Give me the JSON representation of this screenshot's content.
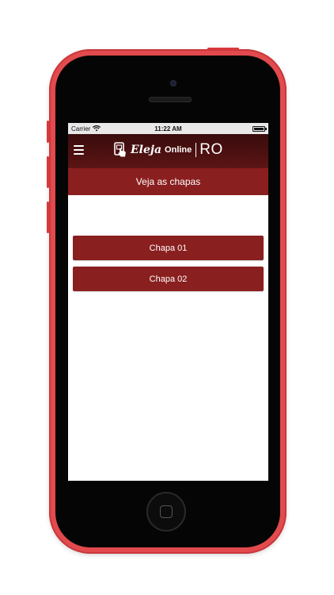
{
  "status_bar": {
    "carrier": "Carrier",
    "time": "11:22 AM"
  },
  "app": {
    "logo_word1": "Eleja",
    "logo_word2": "Online",
    "logo_state": "RO",
    "menu_icon": "hamburger-menu-icon",
    "brand_color": "#8a1f1f"
  },
  "page": {
    "title": "Veja as chapas"
  },
  "chapas": [
    {
      "label": "Chapa 01"
    },
    {
      "label": "Chapa 02"
    }
  ]
}
